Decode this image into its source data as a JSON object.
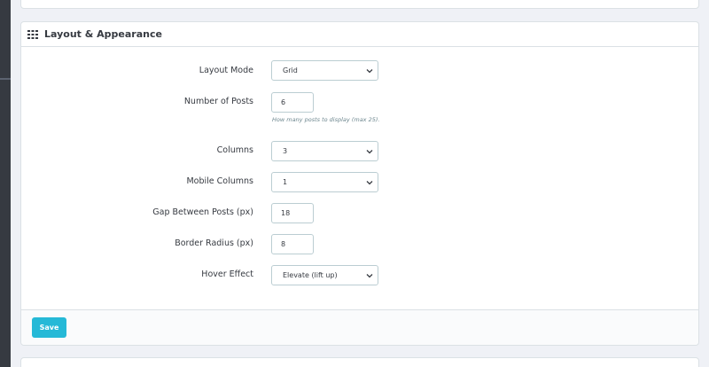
{
  "panel": {
    "title": "Layout & Appearance",
    "icon": "grid-icon"
  },
  "fields": {
    "layout_mode": {
      "label": "Layout Mode",
      "value": "Grid"
    },
    "number_of_posts": {
      "label": "Number of Posts",
      "value": "6",
      "help": "How many posts to display (max 25)."
    },
    "columns": {
      "label": "Columns",
      "value": "3"
    },
    "mobile_columns": {
      "label": "Mobile Columns",
      "value": "1"
    },
    "gap": {
      "label": "Gap Between Posts (px)",
      "value": "18"
    },
    "border_radius": {
      "label": "Border Radius (px)",
      "value": "8"
    },
    "hover_effect": {
      "label": "Hover Effect",
      "value": "Elevate (lift up)"
    }
  },
  "footer": {
    "save_label": "Save"
  },
  "colors": {
    "accent": "#25b9d7",
    "rail": "#363a41",
    "background": "#eff1f6"
  }
}
